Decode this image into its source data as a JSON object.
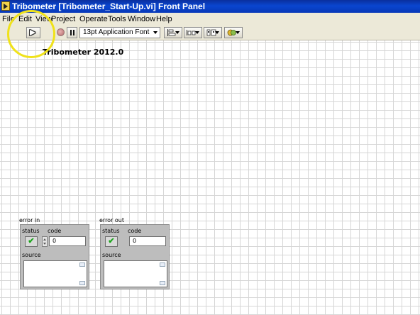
{
  "window": {
    "title": "Tribometer [Tribometer_Start-Up.vi] Front Panel"
  },
  "menubar": {
    "items": [
      "File",
      "Edit",
      "View",
      "Project",
      "Operate",
      "Tools",
      "Window",
      "Help"
    ]
  },
  "toolbar": {
    "run_icon": "run-arrow-icon",
    "abort_icon": "abort-execution-icon",
    "pause_icon": "pause-icon",
    "font": "13pt Application Font",
    "tools": [
      "align-objects-icon",
      "distribute-objects-icon",
      "resize-objects-icon",
      "reorder-objects-icon"
    ]
  },
  "panel": {
    "title": "Tribometer 2012.0"
  },
  "error_in": {
    "label": "error in",
    "status_label": "status",
    "code_label": "code",
    "code_value": "0",
    "source_label": "source"
  },
  "error_out": {
    "label": "error out",
    "status_label": "status",
    "code_label": "code",
    "code_value": "0",
    "source_label": "source"
  },
  "colors": {
    "titlebar": "#0a46cf",
    "highlight": "#f0e21a",
    "status_ok": "#18a518"
  }
}
